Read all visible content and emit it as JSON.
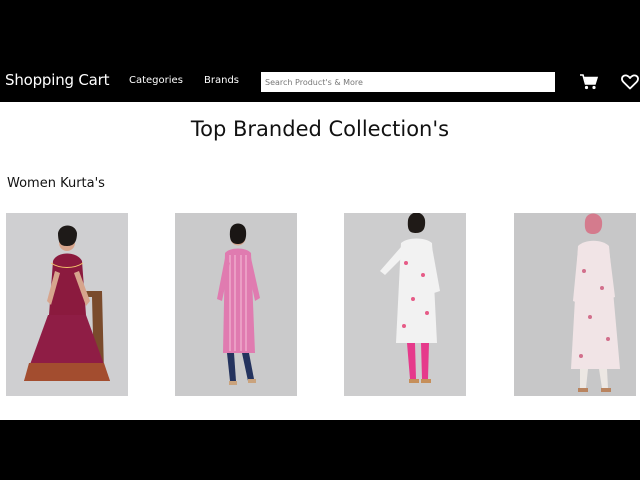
{
  "navbar": {
    "brand": "Shopping Cart",
    "links": [
      "Categories",
      "Brands"
    ],
    "search_placeholder": "Search Product's & More",
    "icons": [
      "cart-icon",
      "heart-icon"
    ]
  },
  "main": {
    "title": "Top Branded Collection's",
    "section_title": "Women Kurta's",
    "products": [
      {
        "name": "maroon-anarkali-kurta",
        "color": "#8b1a3e"
      },
      {
        "name": "pink-striped-kurta",
        "color": "#e07bb0"
      },
      {
        "name": "white-floral-kurta",
        "color": "#f2f2f2"
      },
      {
        "name": "pastel-floral-kurta",
        "color": "#f1e4e6"
      }
    ]
  },
  "colors": {
    "bar": "#000000",
    "page": "#ffffff",
    "text": "#111111"
  }
}
